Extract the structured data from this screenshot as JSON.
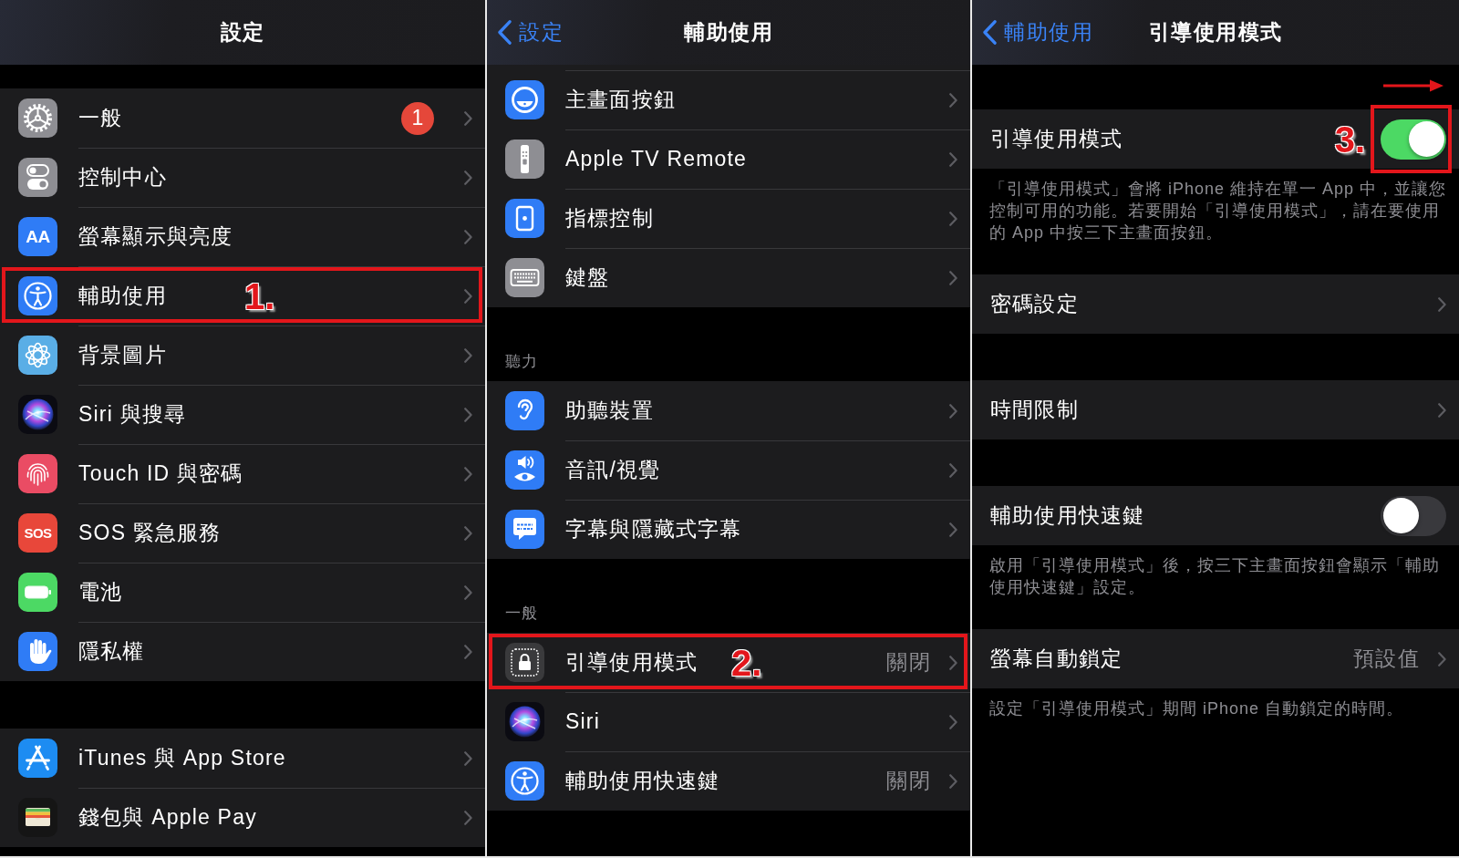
{
  "panels": [
    {
      "kind": "settings",
      "title": "設定",
      "groups": [
        {
          "items": [
            {
              "label": "一般",
              "icon": {
                "kind": "gear"
              },
              "badge": "1"
            },
            {
              "label": "控制中心",
              "icon": {
                "kind": "switches"
              }
            },
            {
              "label": "螢幕顯示與亮度",
              "icon": {
                "kind": "letters",
                "text": "AA"
              }
            },
            {
              "label": "輔助使用",
              "icon": {
                "kind": "accessibility"
              },
              "callout": {
                "label": "1."
              }
            },
            {
              "label": "背景圖片",
              "icon": {
                "kind": "flower"
              }
            },
            {
              "label": "Siri 與搜尋",
              "icon": {
                "kind": "orb"
              }
            },
            {
              "label": "Touch ID 與密碼",
              "icon": {
                "kind": "fingerprint"
              }
            },
            {
              "label": "SOS 緊急服務",
              "icon": {
                "kind": "sos",
                "text": "SOS"
              }
            },
            {
              "label": "電池",
              "icon": {
                "kind": "battery"
              }
            },
            {
              "label": "隱私權",
              "icon": {
                "kind": "hand"
              }
            }
          ]
        },
        {
          "items": [
            {
              "label": "iTunes 與 App Store",
              "icon": {
                "kind": "letter-a"
              }
            },
            {
              "label": "錢包與 Apple Pay",
              "icon": {
                "kind": "wallet"
              }
            }
          ]
        }
      ]
    },
    {
      "kind": "accessibility",
      "back": "設定",
      "title": "輔助使用",
      "groups": [
        {
          "items": [
            {
              "label": "主畫面按鈕",
              "icon": {
                "kind": "circle-button"
              }
            },
            {
              "label": "Apple TV Remote",
              "icon": {
                "kind": "remote"
              }
            },
            {
              "label": "指標控制",
              "icon": {
                "kind": "square-dot"
              }
            },
            {
              "label": "鍵盤",
              "icon": {
                "kind": "keyboard"
              }
            }
          ]
        },
        {
          "header": "聽力",
          "items": [
            {
              "label": "助聽裝置",
              "icon": {
                "kind": "ear"
              }
            },
            {
              "label": "音訊/視覺",
              "icon": {
                "kind": "speaker-eye"
              }
            },
            {
              "label": "字幕與隱藏式字幕",
              "icon": {
                "kind": "speech-bubble"
              }
            }
          ]
        },
        {
          "header": "一般",
          "items": [
            {
              "label": "引導使用模式",
              "icon": {
                "kind": "lock"
              },
              "value": "關閉",
              "callout": {
                "label": "2."
              }
            },
            {
              "label": "Siri",
              "icon": {
                "kind": "orb"
              }
            },
            {
              "label": "輔助使用快速鍵",
              "icon": {
                "kind": "accessibility"
              },
              "value": "關閉"
            }
          ]
        }
      ]
    },
    {
      "kind": "guided-access",
      "back": "輔助使用",
      "title": "引導使用模式",
      "groups": [
        {
          "items": [
            {
              "kind": "toggle",
              "label": "引導使用模式",
              "on": true,
              "callout": {
                "label": "3.",
                "arrow": true
              }
            }
          ],
          "footer": [
            "「引導使用模式」會將 iPhone 維持在單一 App 中，並讓您",
            "控制可用的功能。若要開始「引導使用模式」，請在要使用",
            "的 App 中按三下主畫面按鈕。"
          ]
        },
        {
          "items": [
            {
              "kind": "link",
              "label": "密碼設定"
            }
          ]
        },
        {
          "items": [
            {
              "kind": "link",
              "label": "時間限制"
            }
          ]
        },
        {
          "items": [
            {
              "kind": "toggle",
              "label": "輔助使用快速鍵",
              "on": false
            }
          ],
          "footer": [
            "啟用「引導使用模式」後，按三下主畫面按鈕會顯示「輔助",
            "使用快速鍵」設定。"
          ]
        },
        {
          "items": [
            {
              "kind": "link",
              "label": "螢幕自動鎖定",
              "value": "預設值"
            }
          ],
          "footer": [
            "設定「引導使用模式」期間 iPhone 自動鎖定的時間。"
          ]
        }
      ]
    }
  ]
}
